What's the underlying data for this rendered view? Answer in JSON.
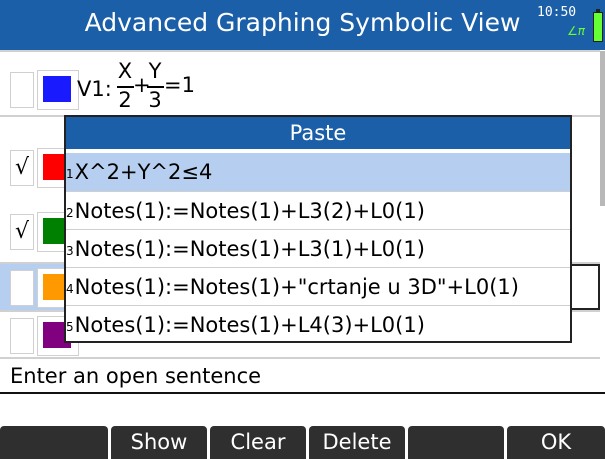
{
  "window": {
    "title": "Advanced Graphing Symbolic View",
    "clock": "10:50",
    "mode_indicator": "∠π",
    "battery": "green"
  },
  "rows": [
    {
      "checked": false,
      "check_mark": "",
      "color": "#1a1aff",
      "label": "V1:",
      "expr": {
        "num1": "X",
        "den1": "2",
        "op": "+",
        "num2": "Y",
        "den2": "3",
        "rhs": "=1"
      }
    },
    {
      "checked": true,
      "check_mark": "√",
      "color": "#ff0000"
    },
    {
      "checked": true,
      "check_mark": "√",
      "color": "#008000"
    },
    {
      "checked": false,
      "check_mark": "",
      "color": "#ff9900"
    },
    {
      "checked": false,
      "check_mark": "",
      "color": "#800080"
    }
  ],
  "paste_dialog": {
    "title": "Paste",
    "items": [
      {
        "num": "1",
        "text": "X^2+Y^2≤4"
      },
      {
        "num": "2",
        "text": "Notes(1):=Notes(1)+L3(2)+L0(1)"
      },
      {
        "num": "3",
        "text": "Notes(1):=Notes(1)+L3(1)+L0(1)"
      },
      {
        "num": "4",
        "text": "Notes(1):=Notes(1)+\"crtanje u 3D\"+L0(1)"
      },
      {
        "num": "5",
        "text": "Notes(1):=Notes(1)+L4(3)+L0(1)"
      }
    ],
    "selected_index": 0
  },
  "prompt": "Enter an open sentence",
  "softkeys": [
    "",
    "Show",
    "Clear",
    "Delete",
    "",
    "OK"
  ],
  "colors": {
    "titlebar": "#1b5fa8",
    "selection": "#b6cff0",
    "softkey": "#2f2f2f"
  }
}
